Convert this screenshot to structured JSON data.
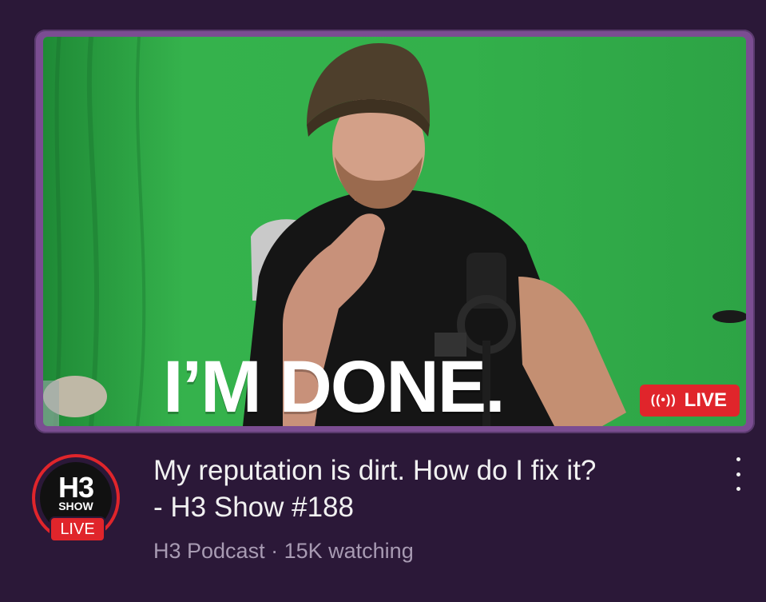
{
  "thumbnail": {
    "overlay_text": "I’M DONE.",
    "live_badge": {
      "broadcast_icon": "((•))",
      "label": "LIVE"
    }
  },
  "channel_avatar": {
    "logo_text": "H3",
    "logo_subtext": "SHOW",
    "live_label": "LIVE"
  },
  "video": {
    "title_line1": "My reputation is dirt. How do I fix it?",
    "title_line2": "- H3 Show #188",
    "channel": "H3 Podcast",
    "separator": "·",
    "viewers": "15K watching"
  },
  "colors": {
    "background": "#2b1838",
    "live_red": "#e0252b",
    "green_screen": "#2fb04a",
    "frame": "#7b4d92"
  },
  "icons": [
    "broadcast-icon",
    "more-vert-icon"
  ]
}
